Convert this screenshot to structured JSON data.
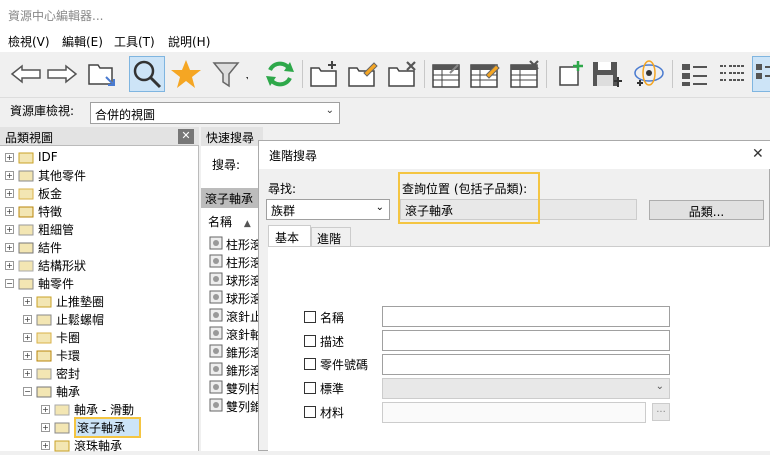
{
  "window": {
    "title": "資源中心編輯器..."
  },
  "menu": [
    "檢視(V)",
    "編輯(E)",
    "工具(T)",
    "說明(H)"
  ],
  "toolbar": {
    "icons": [
      "back-arrow-icon",
      "forward-arrow-icon",
      "folder-icon",
      "search-icon",
      "star-icon",
      "filter-icon",
      "refresh-icon",
      "new-folder-icon",
      "edit-folder-icon",
      "delete-folder-icon",
      "table-icon",
      "edit-table-icon",
      "delete-table-icon",
      "add-item-icon",
      "save-icon",
      "publish-icon",
      "view-list-icon",
      "view-detail-icon",
      "view-icons-icon"
    ],
    "colors": {
      "arrow": "#4a7bd0",
      "star": "#f5a623",
      "refresh": "#2ea84a",
      "active_bg": "#cde4f7"
    }
  },
  "library": {
    "label": "資源庫檢視:",
    "value": "合併的視圖"
  },
  "left_panel": {
    "title": "品類視圖",
    "close": "✕",
    "tree": [
      {
        "label": "IDF",
        "level": 0,
        "expander": "+"
      },
      {
        "label": "其他零件",
        "level": 0,
        "expander": "+"
      },
      {
        "label": "板金",
        "level": 0,
        "expander": "+"
      },
      {
        "label": "特徵",
        "level": 0,
        "expander": "+"
      },
      {
        "label": "粗細管",
        "level": 0,
        "expander": "+"
      },
      {
        "label": "結件",
        "level": 0,
        "expander": "+"
      },
      {
        "label": "結構形狀",
        "level": 0,
        "expander": "+"
      },
      {
        "label": "軸零件",
        "level": 0,
        "expander": "−"
      },
      {
        "label": "止推墊圈",
        "level": 1,
        "expander": "+"
      },
      {
        "label": "止鬆螺帽",
        "level": 1,
        "expander": "+"
      },
      {
        "label": "卡圈",
        "level": 1,
        "expander": "+"
      },
      {
        "label": "卡環",
        "level": 1,
        "expander": "+"
      },
      {
        "label": "密封",
        "level": 1,
        "expander": "+"
      },
      {
        "label": "軸承",
        "level": 1,
        "expander": "−"
      },
      {
        "label": "軸承 - 滑動",
        "level": 2,
        "expander": "+"
      },
      {
        "label": "滾子軸承",
        "level": 2,
        "expander": "+",
        "selected": true
      },
      {
        "label": "滾珠軸承",
        "level": 2,
        "expander": "+"
      }
    ]
  },
  "mid_panel": {
    "quick_title": "快速搜尋",
    "search_label": "搜尋:",
    "result_title": "滾子軸承",
    "col_name": "名稱",
    "rows": [
      "柱形滾",
      "柱形滾",
      "球形滾",
      "球形滾",
      "滾針止",
      "滾針軸",
      "錐形滾",
      "錐形滾",
      "雙列柱",
      "雙列錐"
    ]
  },
  "dialog": {
    "title": "進階搜尋",
    "close": "✕",
    "find_label": "尋找:",
    "find_value": "族群",
    "location_label": "查詢位置 (包括子品類):",
    "location_value": "滾子軸承",
    "category_button": "品類...",
    "tabs": [
      "基本",
      "進階"
    ],
    "fields": [
      {
        "label": "名稱",
        "type": "text"
      },
      {
        "label": "描述",
        "type": "text"
      },
      {
        "label": "零件號碼",
        "type": "text"
      },
      {
        "label": "標準",
        "type": "select"
      },
      {
        "label": "材料",
        "type": "text-browse",
        "browse": "..."
      }
    ],
    "highlight_color": "#f4c542"
  }
}
